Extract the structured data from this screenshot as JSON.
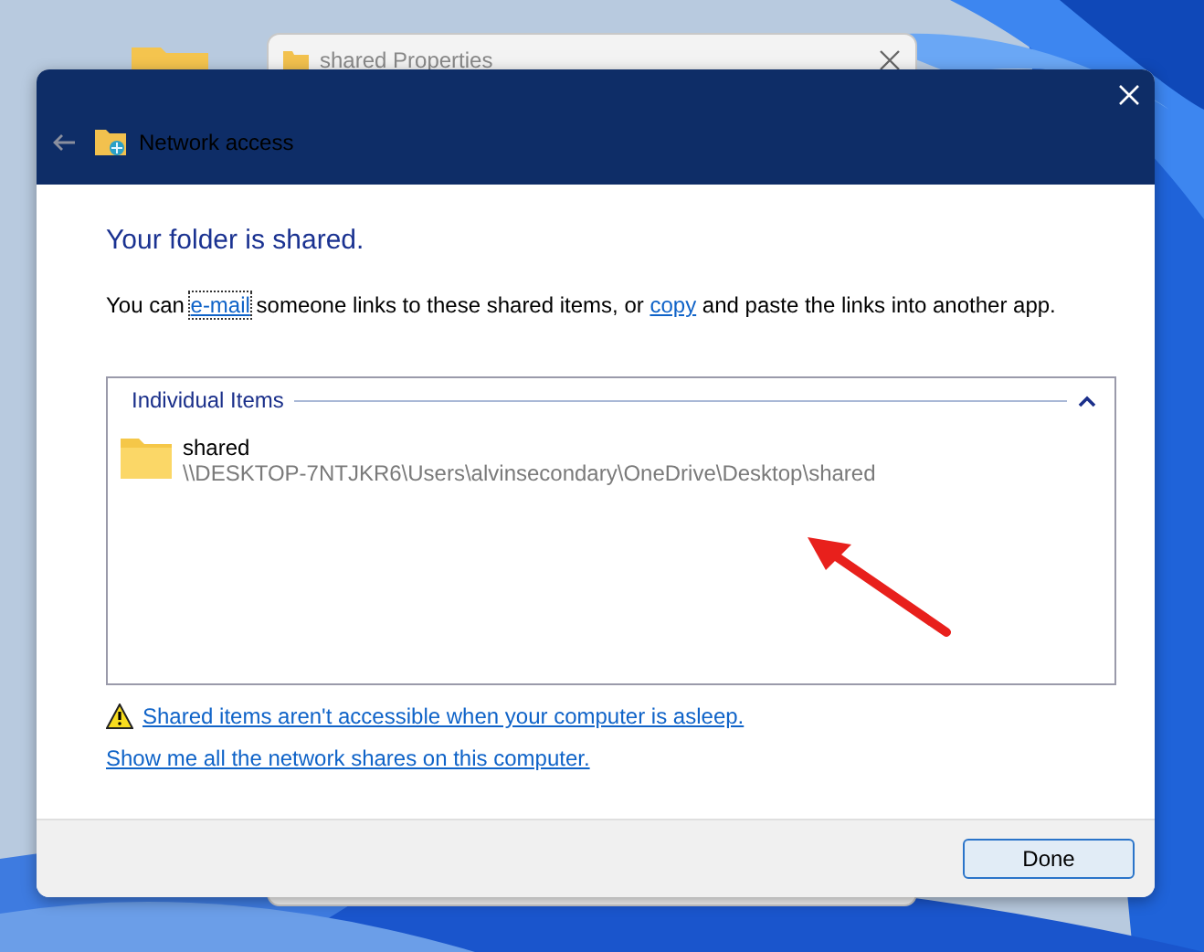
{
  "background_window": {
    "title": "shared Properties"
  },
  "dialog": {
    "title": "Network access",
    "heading": "Your folder is shared.",
    "message": [
      {
        "kind": "text",
        "text": "You can "
      },
      {
        "kind": "link",
        "text": "e-mail",
        "focused": true
      },
      {
        "kind": "text",
        "text": " someone links to these shared items, or "
      },
      {
        "kind": "link",
        "text": "copy",
        "focused": false
      },
      {
        "kind": "text",
        "text": " and paste the links into another app."
      }
    ],
    "group": {
      "title": "Individual Items",
      "expanded": true,
      "items": [
        {
          "name": "shared",
          "path": "\\\\DESKTOP-7NTJKR6\\Users\\alvinsecondary\\OneDrive\\Desktop\\shared"
        }
      ]
    },
    "warning_link": "Shared items aren't accessible when your computer is asleep.",
    "shares_link": "Show me all the network shares on this computer.",
    "buttons": [
      {
        "label": "Done"
      }
    ]
  }
}
